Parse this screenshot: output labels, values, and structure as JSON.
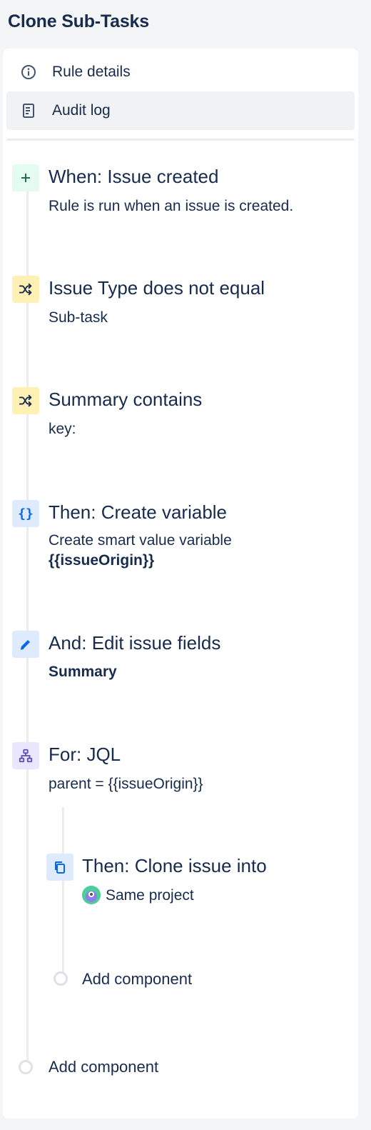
{
  "page": {
    "title": "Clone Sub-Tasks"
  },
  "menu": {
    "items": [
      {
        "label": "Rule details",
        "icon": "info-icon"
      },
      {
        "label": "Audit log",
        "icon": "document-icon"
      }
    ]
  },
  "rule": {
    "trigger": {
      "title": "When: Issue created",
      "description": "Rule is run when an issue is created.",
      "icon": "plus-icon"
    },
    "condition1": {
      "title": "Issue Type does not equal",
      "description": "Sub-task",
      "icon": "shuffle-icon"
    },
    "condition2": {
      "title": "Summary contains",
      "description": "key:",
      "icon": "shuffle-icon"
    },
    "action1": {
      "title": "Then: Create variable",
      "description": "Create smart value variable",
      "variable": "{{issueOrigin}}",
      "icon": "braces-icon"
    },
    "action2": {
      "title": "And: Edit issue fields",
      "description": "Summary",
      "icon": "pencil-icon"
    },
    "branch": {
      "title": "For: JQL",
      "description": "parent = {{issueOrigin}}",
      "icon": "hierarchy-icon",
      "child": {
        "title": "Then: Clone issue into",
        "project": "Same project",
        "icon": "copy-icon"
      },
      "add_label": "Add component"
    },
    "add_label": "Add component"
  },
  "colors": {
    "text": "#172b4d",
    "trigger_bg": "#e3fcef",
    "condition_bg": "#fff0b3",
    "action_bg": "#deebff",
    "branch_bg": "#eae6ff"
  }
}
